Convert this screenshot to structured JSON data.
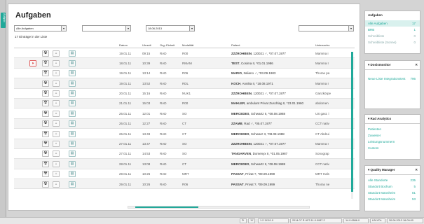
{
  "sidebar_tab": "Aufgab",
  "title": "Aufgaben",
  "filters": {
    "list": "Alle Aufgaben",
    "second": "",
    "date": "18.06.2013",
    "right": ""
  },
  "count": "17 Einträge in der Liste",
  "columns": [
    "Datum",
    "Uhrzeit",
    "Org.-Einheit",
    "Modalität",
    "Patient",
    "Untersuchu"
  ],
  "rows": [
    {
      "date": "19.01.11",
      "time": "09:15",
      "org": "RAD",
      "mod": "R00",
      "patient": "ZZZROHBEIN",
      "detail": ", 120021 ♂, *07.07.1977",
      "exam": "Mamma i",
      "flag": false
    },
    {
      "date": "18.01.11",
      "time": "10:39",
      "org": "RAD",
      "mod": "RMAM",
      "patient": "TEST",
      "detail": ", Cosima II, *01.01.1986",
      "exam": "Mamma I",
      "flag": true
    },
    {
      "date": "19.01.11",
      "time": "13:14",
      "org": "RAD",
      "mod": "R06",
      "patient": "MARIO",
      "detail": ", Italiano ♂, *03.09.1983",
      "exam": "Thorax pa",
      "flag": false
    },
    {
      "date": "19.01.11",
      "time": "13:52",
      "org": "RAD",
      "mod": "RDL",
      "patient": "KOCH",
      "detail": ", Annika II, *18.08.1971",
      "exam": "Mamma I",
      "flag": false
    },
    {
      "date": "20.01.11",
      "time": "15:16",
      "org": "RAD",
      "mod": "NUK1",
      "patient": "ZZZROHBEIN",
      "detail": ", 120021 ♂, *07.07.1977",
      "exam": "Ganzkörpe",
      "flag": false
    },
    {
      "date": "21.01.11",
      "time": "15:03",
      "org": "RAD",
      "mod": "R00",
      "patient": "MAHLER",
      "detail": ", ambulant Privat Zuschlag II, *23.01.1960",
      "exam": "abdomen",
      "flag": false
    },
    {
      "date": "26.01.11",
      "time": "12:01",
      "org": "RAD",
      "mod": "SO",
      "patient": "MERCEDES",
      "detail": ", Schwartz II, *08.08.1988",
      "exam": "US gast. i",
      "flag": false
    },
    {
      "date": "26.01.11",
      "time": "12:27",
      "org": "RAD",
      "mod": "CT",
      "patient": "ZZAMB",
      "detail": ", Rad ♂, *05.07.1977",
      "exam": "CCT nativ",
      "flag": false
    },
    {
      "date": "26.01.11",
      "time": "13:49",
      "org": "RAD",
      "mod": "CT",
      "patient": "MERCEDES",
      "detail": ", Schwarz II, *08.08.1988",
      "exam": "CT Abdrui",
      "flag": false
    },
    {
      "date": "27.01.11",
      "time": "13:47",
      "org": "RAD",
      "mod": "SO",
      "patient": "ZZZROHBEIN",
      "detail": ", 120021 ♂, *07.07.1977",
      "exam": "Mamma I",
      "flag": false
    },
    {
      "date": "27.01.11",
      "time": "14:53",
      "org": "RAD",
      "mod": "SO",
      "patient": "TANGARVEN",
      "detail": ", Domenyx II, *01.05.1987",
      "exam": "Sonograp",
      "flag": false
    },
    {
      "date": "28.01.11",
      "time": "13:08",
      "org": "RAD",
      "mod": "CT",
      "patient": "MERCEDES",
      "detail": ", Schwartz II, *08.08.1988",
      "exam": "CCT nativ",
      "flag": false
    },
    {
      "date": "29.01.11",
      "time": "10:26",
      "org": "RAD",
      "mod": "MRT",
      "patient": "PASSAT",
      "detail": ", Privat ?, *09.09.1999",
      "exam": "MRT Hals",
      "flag": false
    },
    {
      "date": "29.01.11",
      "time": "10:26",
      "org": "RAD",
      "mod": "R06",
      "patient": "PASSAT",
      "detail": ", Privat ?, *09.09.1999",
      "exam": "Thorax ne",
      "flag": false
    }
  ],
  "tasks_panel": {
    "title": "Aufgaben",
    "items": [
      {
        "label": "Alle Aufgaben",
        "value": "17"
      },
      {
        "label": "BRB",
        "value": "1"
      },
      {
        "label": "Schreibliste",
        "value": "0"
      },
      {
        "label": "Schreibliste (Sonne)",
        "value": "0"
      }
    ]
  },
  "dosis_panel": {
    "title": "Dosismonitor",
    "items": [
      {
        "label": "Neue Liste Integrationstest",
        "value": "796"
      }
    ]
  },
  "analytics_panel": {
    "title": "Rad Analytics",
    "items": [
      "Patienten",
      "Zuweiser",
      "Leistungsnummern",
      "Custom"
    ]
  },
  "quality_panel": {
    "title": "Quality Manager",
    "items": [
      {
        "label": "Alle Standorte",
        "value": "235"
      },
      {
        "label": "Standort Bochum",
        "value": "5"
      },
      {
        "label": "Standort Mannheim",
        "value": "81"
      },
      {
        "label": "Standort Mannheim",
        "value": "53"
      }
    ]
  },
  "statusbar": {
    "version": "1.2.11111.0",
    "build": "2014.07 R HF2.11.0.0087.2",
    "server": "14.0.0886.0",
    "code": "LBLYDL",
    "datetime": "30.06.2013 16:09:00"
  }
}
